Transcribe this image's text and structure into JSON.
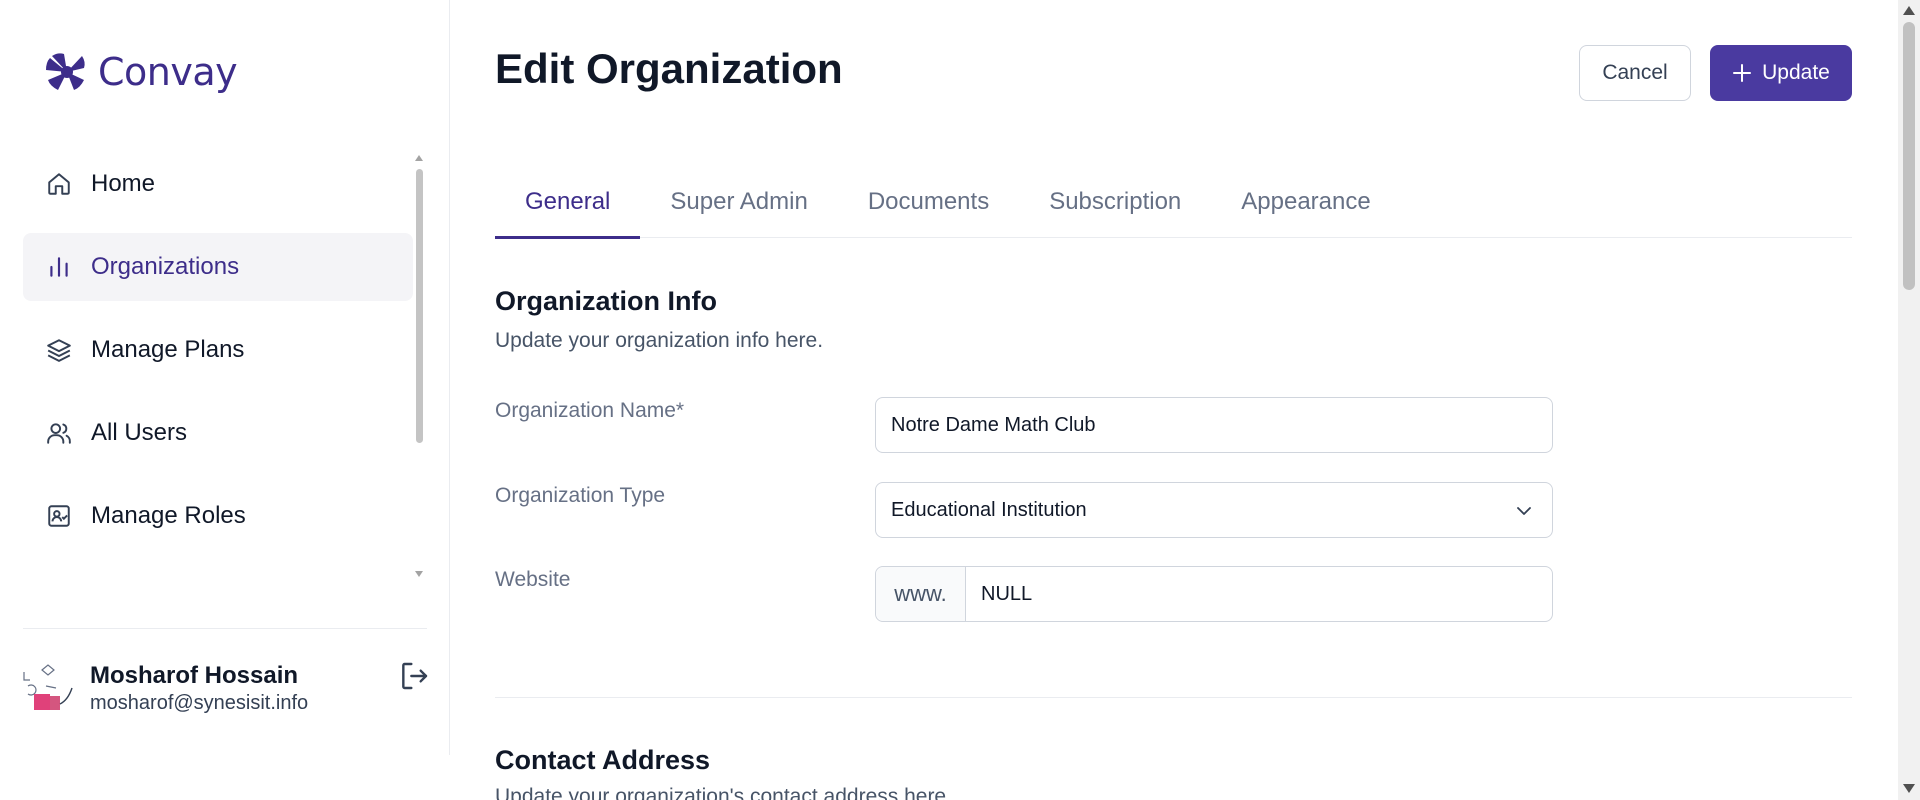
{
  "app": {
    "name": "Convay"
  },
  "sidebar": {
    "items": [
      {
        "label": "Home",
        "icon": "home-icon"
      },
      {
        "label": "Organizations",
        "icon": "bar-chart-icon",
        "active": true
      },
      {
        "label": "Manage Plans",
        "icon": "layers-icon"
      },
      {
        "label": "All Users",
        "icon": "users-icon"
      },
      {
        "label": "Manage Roles",
        "icon": "role-badge-icon"
      }
    ]
  },
  "user": {
    "name": "Mosharof Hossain",
    "email": "mosharof@synesisit.info"
  },
  "header": {
    "title": "Edit Organization",
    "cancel_label": "Cancel",
    "update_label": "Update"
  },
  "tabs": [
    {
      "label": "General",
      "active": true
    },
    {
      "label": "Super Admin"
    },
    {
      "label": "Documents"
    },
    {
      "label": "Subscription"
    },
    {
      "label": "Appearance"
    }
  ],
  "org_info": {
    "title": "Organization Info",
    "subtitle": "Update your organization info here.",
    "name_label": "Organization Name*",
    "name_value": "Notre Dame Math Club",
    "type_label": "Organization Type",
    "type_value": "Educational Institution",
    "website_label": "Website",
    "website_prefix": "www.",
    "website_value": "NULL"
  },
  "contact": {
    "title": "Contact Address",
    "subtitle": "Update your organization's contact address here."
  },
  "colors": {
    "brand": "#3d2d8a",
    "primary_button": "#4a3aa0",
    "active_bg": "#f4f4f7"
  }
}
